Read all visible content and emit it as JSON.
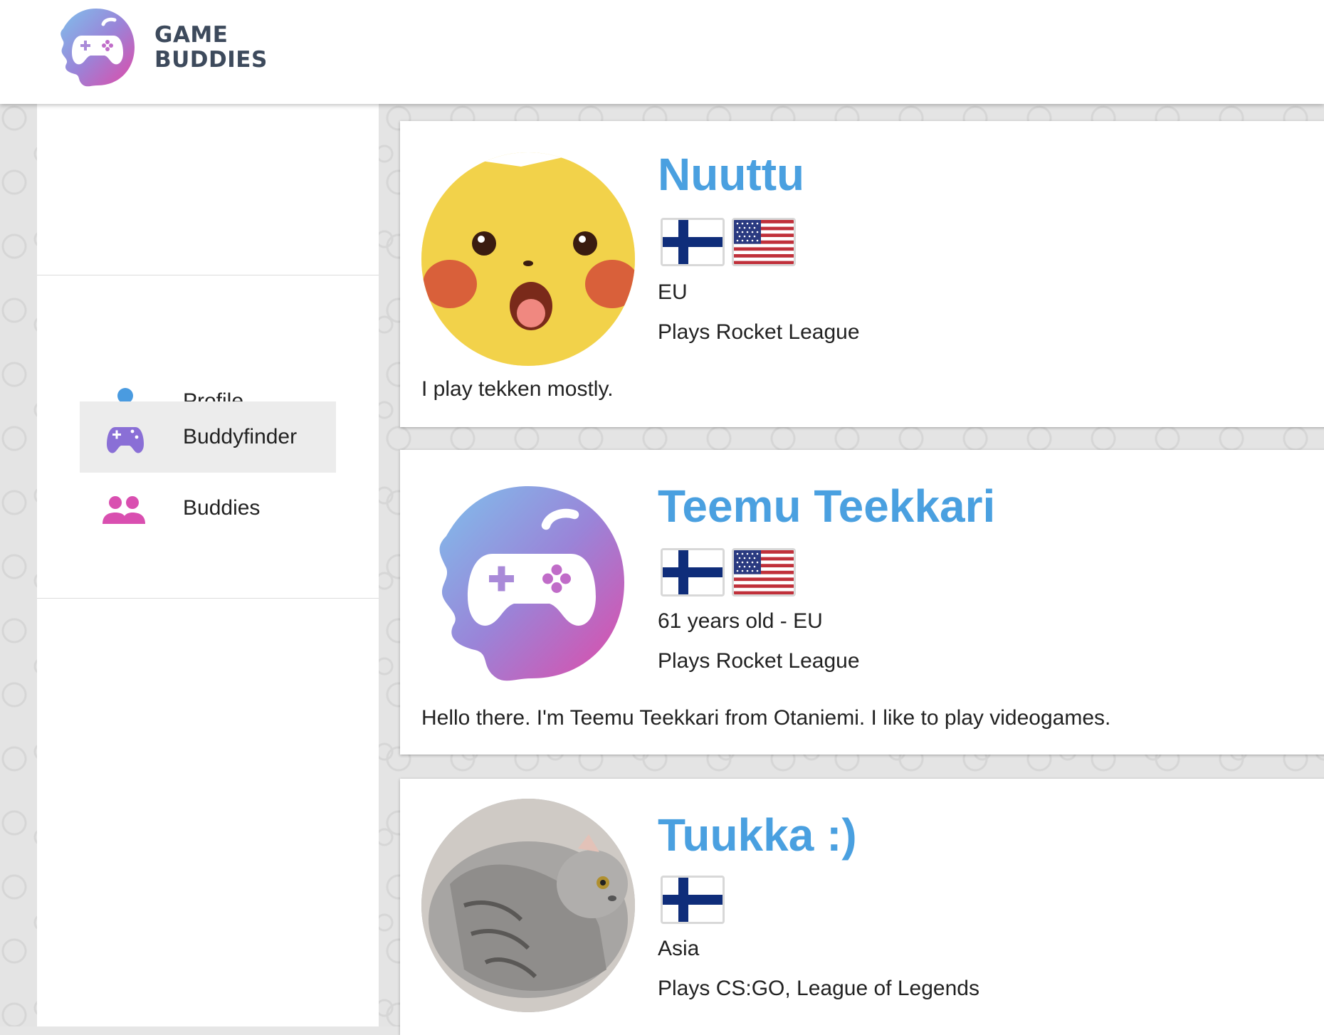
{
  "header": {
    "brand_line1": "GAME",
    "brand_line2": "BUDDIES",
    "logo_icon": "gamepad-splash-logo",
    "brand_colors": [
      "#7fb8e8",
      "#9a7ed6",
      "#d94fb0"
    ]
  },
  "sidebar": {
    "items": [
      {
        "label": "Profile",
        "icon": "person-icon",
        "color": "#4a9be0",
        "active": false
      },
      {
        "label": "Buddyfinder",
        "icon": "gamepad-icon",
        "color": "#8a6fd6",
        "active": true
      },
      {
        "label": "Buddies",
        "icon": "people-icon",
        "color": "#d94fb0",
        "active": false
      }
    ]
  },
  "cards": [
    {
      "name": "Nuuttu",
      "avatar": "surprised-pikachu-avatar",
      "flags": [
        "finland-flag",
        "usa-flag"
      ],
      "meta1": "EU",
      "meta2": "Plays Rocket League",
      "bio": "I play tekken mostly."
    },
    {
      "name": "Teemu Teekkari",
      "avatar": "game-buddies-logo-avatar",
      "flags": [
        "finland-flag",
        "usa-flag"
      ],
      "meta1": "61 years old - EU",
      "meta2": "Plays Rocket League",
      "bio": "Hello there. I'm Teemu Teekkari from Otaniemi. I like to play videogames."
    },
    {
      "name": "Tuukka :)",
      "avatar": "gray-cat-avatar",
      "flags": [
        "finland-flag"
      ],
      "meta1": "Asia",
      "meta2": "Plays CS:GO, League of Legends",
      "bio": ""
    }
  ],
  "colors": {
    "name": "#4aa0e0",
    "active_bg": "#ececec"
  }
}
